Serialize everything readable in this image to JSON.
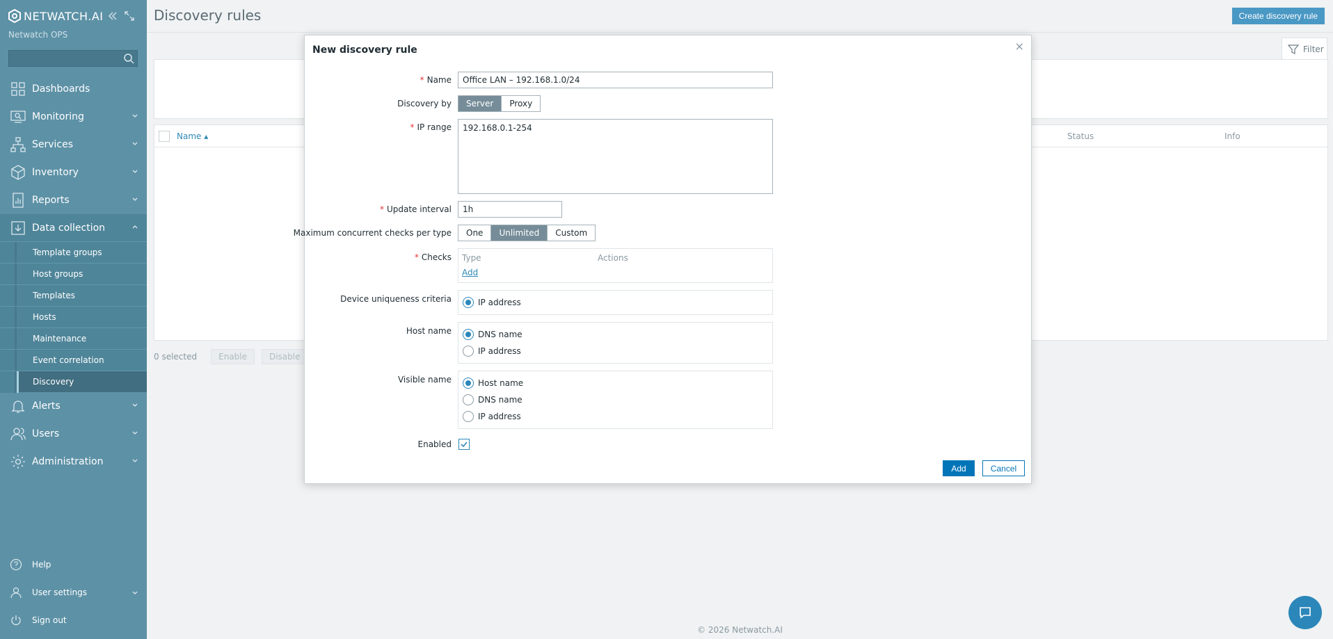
{
  "sidebar": {
    "logo_text": "NETWATCH",
    "logo_suffix": ".AI",
    "org": "Netwatch OPS",
    "search_placeholder": "",
    "items": [
      {
        "label": "Dashboards",
        "icon": "dashboards-icon"
      },
      {
        "label": "Monitoring",
        "icon": "monitoring-icon"
      },
      {
        "label": "Services",
        "icon": "services-icon"
      },
      {
        "label": "Inventory",
        "icon": "inventory-icon"
      },
      {
        "label": "Reports",
        "icon": "reports-icon"
      },
      {
        "label": "Data collection",
        "icon": "data-collection-icon"
      },
      {
        "label": "Alerts",
        "icon": "alerts-icon"
      },
      {
        "label": "Users",
        "icon": "users-icon"
      },
      {
        "label": "Administration",
        "icon": "administration-icon"
      }
    ],
    "sub_items": [
      "Template groups",
      "Host groups",
      "Templates",
      "Hosts",
      "Maintenance",
      "Event correlation",
      "Discovery"
    ],
    "footer_items": [
      "Help",
      "User settings",
      "Sign out"
    ]
  },
  "main": {
    "title": "Discovery rules",
    "create_button": "Create discovery rule",
    "filter_label": "Filter",
    "columns": {
      "name": "Name",
      "status": "Status",
      "info": "Info"
    },
    "selected": "0 selected",
    "enable": "Enable",
    "disable": "Disable",
    "footer": "© 2026 Netwatch.AI"
  },
  "dialog": {
    "title": "New discovery rule",
    "name_label": "Name",
    "name_value": "Office LAN – 192.168.1.0/24",
    "discovery_by_label": "Discovery by",
    "discovery_by": [
      "Server",
      "Proxy"
    ],
    "ip_range_label": "IP range",
    "ip_range_value": "192.168.0.1-254",
    "update_interval_label": "Update interval",
    "update_interval_value": "1h",
    "max_checks_label": "Maximum concurrent checks per type",
    "max_checks": [
      "One",
      "Unlimited",
      "Custom"
    ],
    "checks_label": "Checks",
    "checks_type": "Type",
    "checks_actions": "Actions",
    "checks_add": "Add",
    "uniqueness_label": "Device uniqueness criteria",
    "uniqueness_option": "IP address",
    "host_name_label": "Host name",
    "host_name_options": [
      "DNS name",
      "IP address"
    ],
    "visible_name_label": "Visible name",
    "visible_name_options": [
      "Host name",
      "DNS name",
      "IP address"
    ],
    "enabled_label": "Enabled",
    "add_button": "Add",
    "cancel_button": "Cancel"
  }
}
